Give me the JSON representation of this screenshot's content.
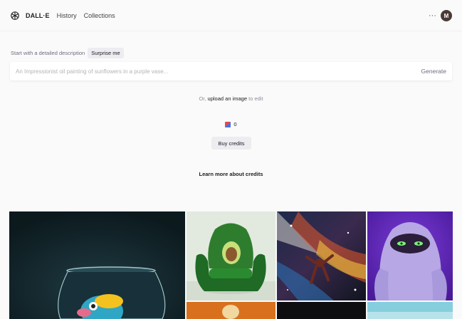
{
  "header": {
    "brand": "DALL·E",
    "nav": [
      {
        "label": "History"
      },
      {
        "label": "Collections"
      }
    ],
    "more_label": "···",
    "avatar_initial": "M"
  },
  "prompt": {
    "label": "Start with a detailed description",
    "surprise_label": "Surprise me",
    "placeholder": "An Impressionist oil painting of sunflowers in a purple vase...",
    "value": "",
    "generate_label": "Generate"
  },
  "upload": {
    "prefix": "Or,",
    "link": "upload an image",
    "suffix": "to edit"
  },
  "credits": {
    "count": "0",
    "buy_label": "Buy credits",
    "learn_more_label": "Learn more about credits"
  },
  "gallery": [
    {
      "subject": "fishbowl"
    },
    {
      "subject": "avocado-armchair"
    },
    {
      "subject": "space-painting"
    },
    {
      "subject": "purple-monster"
    },
    {
      "subject": "orange-image"
    },
    {
      "subject": "dark-image"
    },
    {
      "subject": "blue-image"
    }
  ],
  "colors": {
    "background": "#fafafa",
    "button_bg": "#ececf1",
    "text": "#202123",
    "muted": "#6e6e80",
    "avatar": "#4a3b36"
  }
}
